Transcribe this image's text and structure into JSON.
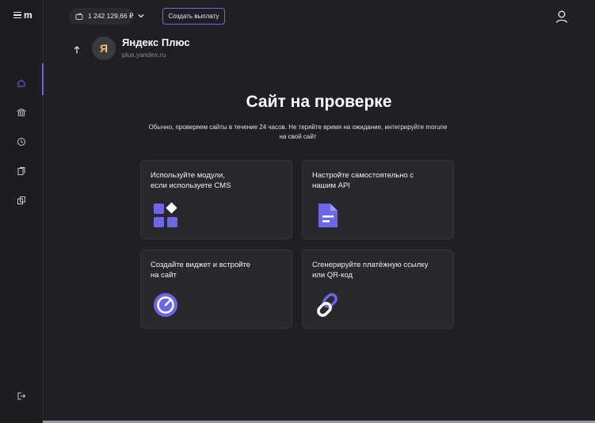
{
  "app": {
    "logo_letter": "m"
  },
  "sidebar": {
    "items": [
      {
        "icon": "home-icon",
        "active": true
      },
      {
        "icon": "bank-icon",
        "active": false
      },
      {
        "icon": "history-icon",
        "active": false
      },
      {
        "icon": "documents-icon",
        "active": false
      },
      {
        "icon": "copy-icon",
        "active": false
      }
    ],
    "logout_icon": "logout-icon"
  },
  "header": {
    "balance": "1 242 129,66 ₽",
    "payout_button": "Создать выплату"
  },
  "merchant": {
    "avatar_letter": "Я",
    "name": "Яндекс Плюс",
    "url": "plus.yandex.ru"
  },
  "main": {
    "title": "Сайт на проверке",
    "subtitle": "Обычно, проверяем сайты в течение 24 часов. Не теряйте время на ожидание, интегрируйте morune на свой сайт",
    "cards": [
      {
        "title": "Используйте модули,\nесли используете CMS",
        "icon": "modules-icon"
      },
      {
        "title": "Настройте самостоятельно с\nнашим API",
        "icon": "document-icon"
      },
      {
        "title": "Создайте виджет и встройте\nна сайт",
        "icon": "widget-icon"
      },
      {
        "title": "Сгенерируйте платёжную ссылку\nили QR-код",
        "icon": "link-icon"
      }
    ]
  },
  "colors": {
    "accent": "#6b67e8",
    "background": "#1f1f24",
    "card": "#28282e",
    "avatar_letter": "#f3c84a"
  }
}
